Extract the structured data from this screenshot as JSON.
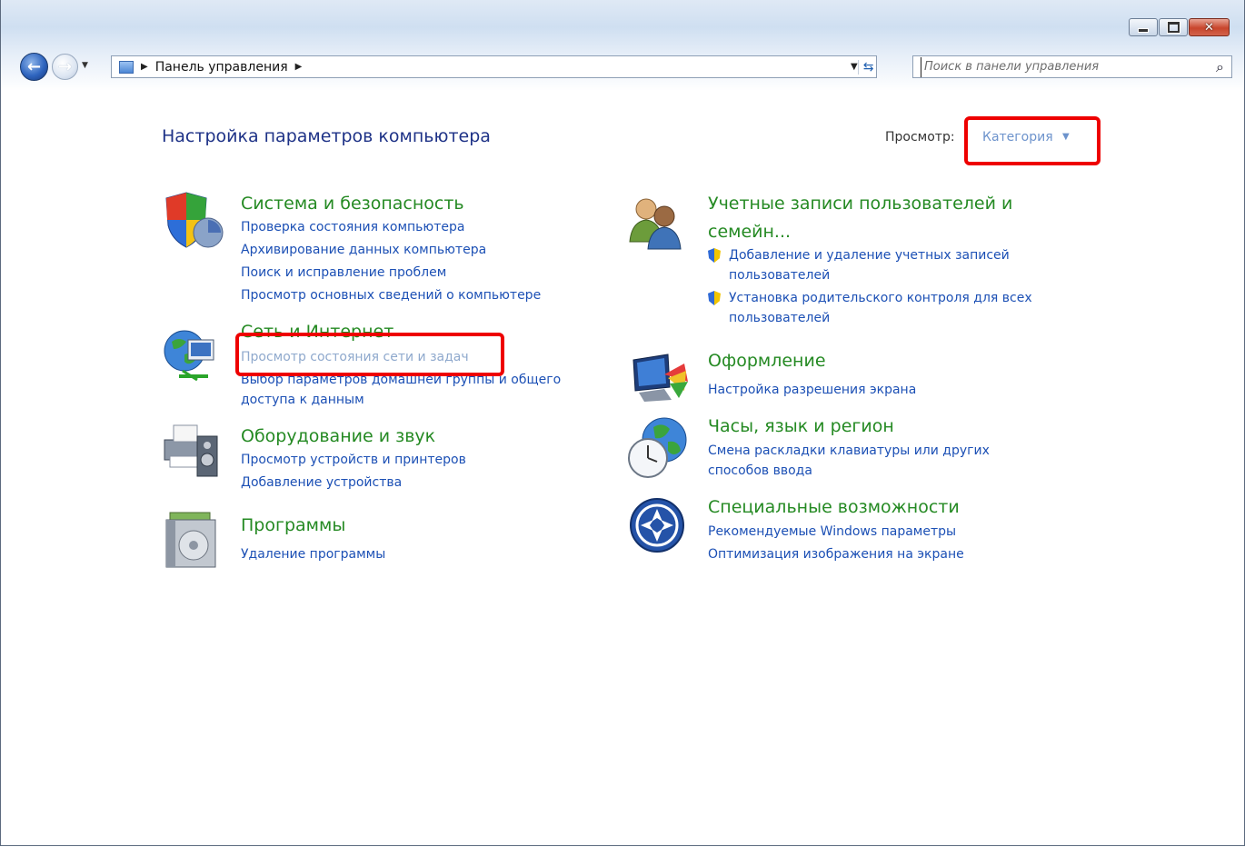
{
  "window": {
    "caption_buttons": [
      "minimize-icon",
      "maximize-icon",
      "close-icon"
    ]
  },
  "nav": {
    "back_icon": "back-arrow-icon",
    "forward_icon": "forward-arrow-icon",
    "breadcrumb": "Панель управления",
    "search_placeholder": "Поиск в панели управления"
  },
  "header": {
    "title": "Настройка параметров компьютера",
    "view_label": "Просмотр:",
    "view_value": "Категория"
  },
  "categories": {
    "security": {
      "title": "Система и безопасность",
      "links": [
        "Проверка состояния компьютера",
        "Архивирование данных компьютера",
        "Поиск и исправление проблем",
        "Просмотр основных сведений о компьютере"
      ]
    },
    "network": {
      "title": "Сеть и Интернет",
      "links": [
        "Просмотр состояния сети и задач",
        "Выбор параметров домашней группы и общего",
        "доступа к данным"
      ]
    },
    "hardware": {
      "title": "Оборудование и звук",
      "links": [
        "Просмотр устройств и принтеров",
        "Добавление устройства"
      ]
    },
    "programs": {
      "title": "Программы",
      "links": [
        "Удаление программы"
      ]
    },
    "accounts": {
      "title_line1": "Учетные записи пользователей и",
      "title_line2": "семейн...",
      "links": [
        "Добавление и удаление учетных записей",
        "пользователей",
        "Установка родительского контроля для всех",
        "пользователей"
      ]
    },
    "appearance": {
      "title": "Оформление",
      "links": [
        "Настройка разрешения экрана"
      ]
    },
    "clock": {
      "title": "Часы, язык и регион",
      "links": [
        "Смена раскладки клавиатуры или других",
        "способов ввода"
      ]
    },
    "access": {
      "title": "Специальные возможности",
      "links": [
        "Рекомендуемые Windows параметры",
        "Оптимизация изображения на экране"
      ]
    }
  },
  "colors": {
    "category_title": "#258a23",
    "link": "#1c50b5",
    "highlight": "#ee0000"
  }
}
